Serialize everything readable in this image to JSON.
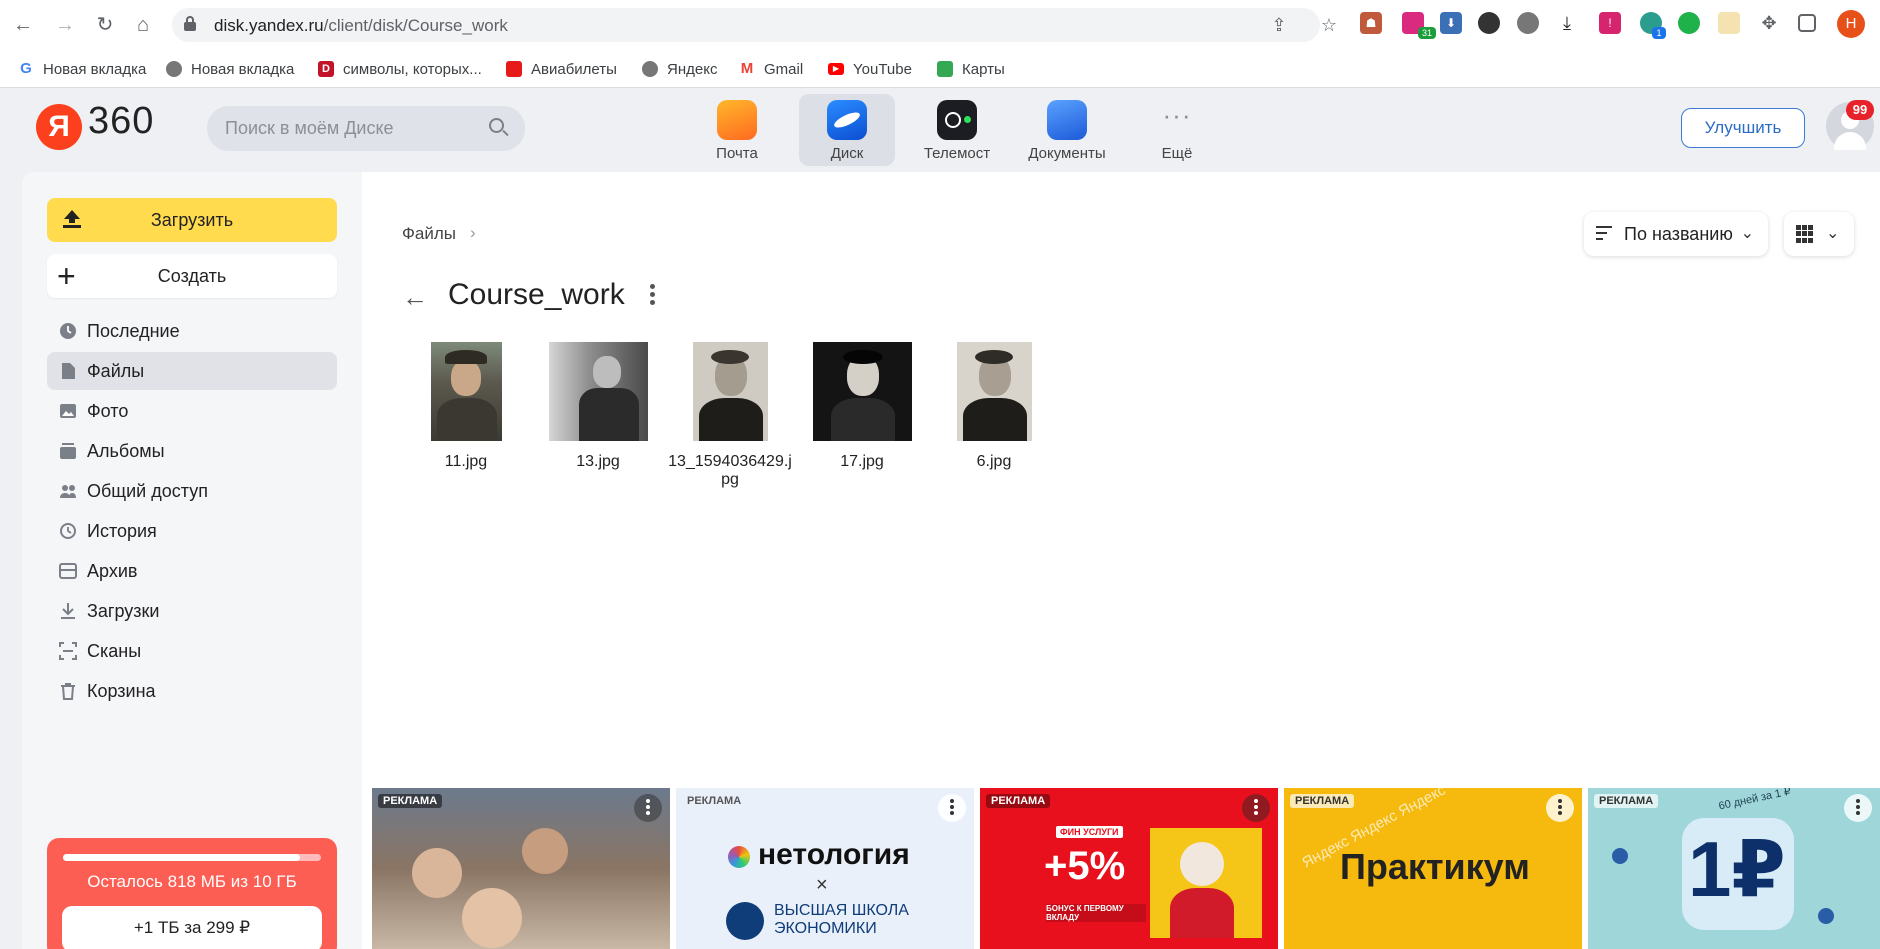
{
  "browser": {
    "url_host": "disk.yandex.ru",
    "url_path": "/client/disk/Course_work",
    "profile_initial": "Н",
    "extension_badges": [
      "31",
      "1"
    ],
    "bookmarks": [
      {
        "label": "Новая вкладка",
        "icon": "google-icon"
      },
      {
        "label": "Новая вкладка",
        "icon": "globe-icon"
      },
      {
        "label": "символы, которых...",
        "icon": "d-icon"
      },
      {
        "label": "Авиабилеты",
        "icon": "aviasales-icon"
      },
      {
        "label": "Яндекс",
        "icon": "globe-icon"
      },
      {
        "label": "Gmail",
        "icon": "gmail-icon"
      },
      {
        "label": "YouTube",
        "icon": "youtube-icon"
      },
      {
        "label": "Карты",
        "icon": "maps-icon"
      }
    ]
  },
  "header": {
    "logo_letter": "Я",
    "logo_text": "360",
    "search_placeholder": "Поиск в моём Диске",
    "apps": [
      {
        "label": "Почта",
        "icon": "mail-icon"
      },
      {
        "label": "Диск",
        "icon": "disk-icon"
      },
      {
        "label": "Телемост",
        "icon": "telemost-icon"
      },
      {
        "label": "Документы",
        "icon": "documents-icon"
      },
      {
        "label": "Ещё",
        "icon": "more-icon"
      }
    ],
    "upgrade_label": "Улучшить",
    "notification_count": "99"
  },
  "sidebar": {
    "upload_label": "Загрузить",
    "create_label": "Создать",
    "items": [
      {
        "label": "Последние",
        "icon": "clock-icon"
      },
      {
        "label": "Файлы",
        "icon": "file-icon"
      },
      {
        "label": "Фото",
        "icon": "photo-icon"
      },
      {
        "label": "Альбомы",
        "icon": "albums-icon"
      },
      {
        "label": "Общий доступ",
        "icon": "shared-icon"
      },
      {
        "label": "История",
        "icon": "history-icon"
      },
      {
        "label": "Архив",
        "icon": "archive-icon"
      },
      {
        "label": "Загрузки",
        "icon": "download-icon"
      },
      {
        "label": "Сканы",
        "icon": "scan-icon"
      },
      {
        "label": "Корзина",
        "icon": "trash-icon"
      }
    ],
    "active_index": 1,
    "storage": {
      "text": "Осталось 818 МБ из 10 ГБ",
      "used_fraction": 0.92,
      "buy_label": "+1 ТБ за 299 ₽"
    }
  },
  "main": {
    "breadcrumb": "Файлы",
    "folder_title": "Course_work",
    "sort_label": "По названию",
    "files": [
      {
        "name": "11.jpg"
      },
      {
        "name": "13.jpg"
      },
      {
        "name": "13_1594036429.jpg"
      },
      {
        "name": "17.jpg"
      },
      {
        "name": "6.jpg"
      }
    ],
    "ads": [
      {
        "tag": "РЕКЛАМА",
        "text": ""
      },
      {
        "tag": "РЕКЛАМА",
        "text": "нетология",
        "sub1": "×",
        "sub2": "ВЫСШАЯ ШКОЛА",
        "sub3": "ЭКОНОМИКИ"
      },
      {
        "tag": "РЕКЛАМА",
        "text": "+5%",
        "sub1": "ФИН УСЛУГИ",
        "sub2": "БОНУС К ПЕРВОМУ ВКЛАДУ"
      },
      {
        "tag": "РЕКЛАМА",
        "text": "Практикум",
        "sub1": "Яндекс"
      },
      {
        "tag": "РЕКЛАМА",
        "text": "1₽",
        "sub1": "60 дней за 1 ₽"
      }
    ]
  }
}
